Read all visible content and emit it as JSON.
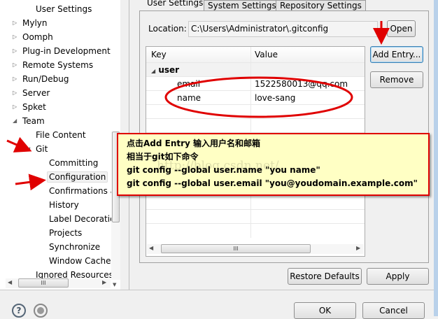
{
  "tree": {
    "items": [
      {
        "label": "User Settings",
        "level": 2
      },
      {
        "label": "Mylyn",
        "level": 1,
        "expander": "collapsed"
      },
      {
        "label": "Oomph",
        "level": 1,
        "expander": "collapsed"
      },
      {
        "label": "Plug-in Development",
        "level": 1,
        "expander": "collapsed"
      },
      {
        "label": "Remote Systems",
        "level": 1,
        "expander": "collapsed"
      },
      {
        "label": "Run/Debug",
        "level": 1,
        "expander": "collapsed"
      },
      {
        "label": "Server",
        "level": 1,
        "expander": "collapsed"
      },
      {
        "label": "Spket",
        "level": 1,
        "expander": "collapsed"
      },
      {
        "label": "Team",
        "level": 1,
        "expander": "expanded"
      },
      {
        "label": "File Content",
        "level": 2
      },
      {
        "label": "Git",
        "level": 2,
        "expander": "expanded"
      },
      {
        "label": "Committing",
        "level": 3
      },
      {
        "label": "Configuration",
        "level": 3,
        "selected": true
      },
      {
        "label": "Confirmations and Warnings",
        "level": 3
      },
      {
        "label": "History",
        "level": 3
      },
      {
        "label": "Label Decorations",
        "level": 3
      },
      {
        "label": "Projects",
        "level": 3
      },
      {
        "label": "Synchronize",
        "level": 3
      },
      {
        "label": "Window Cache",
        "level": 3
      },
      {
        "label": "Ignored Resources",
        "level": 2
      }
    ],
    "hscroll_glyph": "III"
  },
  "tabs": [
    "User Settings",
    "System Settings",
    "Repository Settings"
  ],
  "location": {
    "label": "Location:",
    "value": "C:\\Users\\Administrator\\.gitconfig",
    "open_button": "Open"
  },
  "table": {
    "headers": [
      "Key",
      "Value"
    ],
    "group": "user",
    "rows": [
      {
        "key": "email",
        "value": "1522580013@qq.com"
      },
      {
        "key": "name",
        "value": "love-sang"
      }
    ],
    "hscroll_glyph": "III"
  },
  "buttons": {
    "add_entry": "Add Entry...",
    "remove": "Remove",
    "restore_defaults": "Restore Defaults",
    "apply": "Apply",
    "ok": "OK",
    "cancel": "Cancel"
  },
  "note": {
    "lines": [
      "点击Add Entry 输入用户名和邮箱",
      "相当于git如下命令",
      "git config --global user.name \"you name\"",
      "git config --global user.email \"you@youdomain.example.com\""
    ],
    "watermark": "http://blog.csdn.net/"
  },
  "colors": {
    "annotation": "#e00000",
    "note_bg": "#ffffc4"
  }
}
